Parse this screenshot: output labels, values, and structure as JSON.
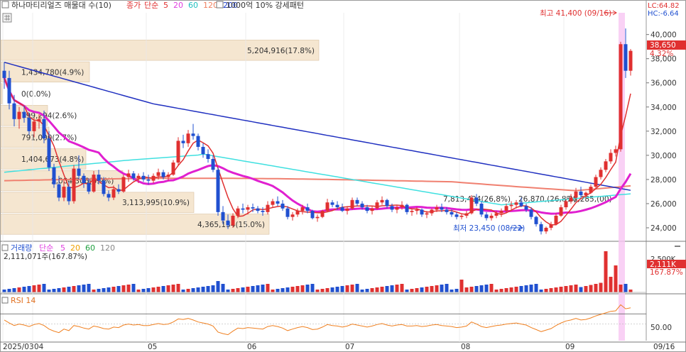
{
  "main_header": {
    "stock_name": "하나마티리얼즈 매물대 수(10)",
    "price_type": "종가",
    "ma_label": "단순",
    "ma_periods": [
      {
        "v": "5",
        "color": "#e03030"
      },
      {
        "v": "20",
        "color": "#e040e0"
      },
      {
        "v": "60",
        "color": "#20c0c0"
      },
      {
        "v": "120",
        "color": "#f08060"
      },
      {
        "v": "200",
        "color": "#2040d0"
      }
    ],
    "pattern_label": "1000억 10% 강세패턴"
  },
  "lc_label": "LC:64.82",
  "hc_label": "HC:-6.64",
  "price_scale": [
    "40,000",
    "38,000",
    "36,000",
    "34,000",
    "32,000",
    "30,000",
    "28,000",
    "26,000",
    "24,000"
  ],
  "current_price": "38,650",
  "current_change": "4.32%",
  "high_annotation": "최고 41,400 (09/16)",
  "low_annotation": "최저 23,450 (08/22)",
  "volume_profile": [
    {
      "price_hi": 41400,
      "price_lo": 39600,
      "label": "",
      "width": 0
    },
    {
      "price_hi": 39600,
      "price_lo": 37800,
      "label": "5,204,916(17.8%)",
      "width": 448
    },
    {
      "price_hi": 37800,
      "price_lo": 36000,
      "label": "1,434,780(4.9%)",
      "width": 125
    },
    {
      "price_hi": 36000,
      "price_lo": 34200,
      "label": "0(0.0%)",
      "width": 2
    },
    {
      "price_hi": 34200,
      "price_lo": 32400,
      "label": "799,294(2.6%)",
      "width": 66
    },
    {
      "price_hi": 32400,
      "price_lo": 30600,
      "label": "791,000(2.7%)",
      "width": 68
    },
    {
      "price_hi": 30600,
      "price_lo": 28800,
      "label": "1,404,673(4.8%)",
      "width": 120
    },
    {
      "price_hi": 28800,
      "price_lo": 27000,
      "label": "2,004,306(6.9%)",
      "width": 172
    },
    {
      "price_hi": 27000,
      "price_lo": 25200,
      "label": "3,113,995(10.9%)",
      "width": 272
    },
    {
      "price_hi": 25200,
      "price_lo": 23400,
      "label": "4,365,134(15.0%)",
      "width": 378
    }
  ],
  "volume_profile_extra": [
    "7,813,424(26,8%)",
    "26,870,(26,8%)",
    "28,285,(00)"
  ],
  "volume_header": {
    "label": "거래량",
    "ma_label": "단순",
    "periods": [
      {
        "v": "5",
        "color": "#e040e0"
      },
      {
        "v": "20",
        "color": "#f0a000"
      },
      {
        "v": "60",
        "color": "#20a040"
      },
      {
        "v": "120",
        "color": "#888888"
      }
    ]
  },
  "volume_value": "2,111,071주(167.87%)",
  "volume_scale": "2,500K",
  "volume_current": "2,111K",
  "volume_pct": "167.87%",
  "rsi_label": "RSI 14",
  "rsi_scale": "50.00",
  "x_axis": [
    "2025/03",
    "04",
    "05",
    "06",
    "07",
    "08",
    "09"
  ],
  "x_axis_right": "09/16",
  "chart_data": {
    "type": "candlestick",
    "y_range": [
      23000,
      41800
    ],
    "candles": [
      [
        37000,
        37700,
        35500,
        36400
      ],
      [
        36400,
        37000,
        33800,
        34300
      ],
      [
        34300,
        35000,
        32400,
        33000
      ],
      [
        33000,
        34000,
        32200,
        33600
      ],
      [
        33600,
        34100,
        32700,
        33100
      ],
      [
        33100,
        33500,
        31700,
        32000
      ],
      [
        32000,
        33100,
        31500,
        32800
      ],
      [
        32800,
        33400,
        32200,
        33000
      ],
      [
        33000,
        33700,
        31000,
        31400
      ],
      [
        31400,
        32000,
        28700,
        29000
      ],
      [
        29000,
        29300,
        27300,
        27600
      ],
      [
        27600,
        28300,
        26200,
        26500
      ],
      [
        26500,
        28000,
        26200,
        27400
      ],
      [
        27400,
        27800,
        25900,
        26200
      ],
      [
        26200,
        29200,
        26000,
        28900
      ],
      [
        28900,
        30000,
        28000,
        28300
      ],
      [
        28300,
        28500,
        27300,
        27700
      ],
      [
        27700,
        28100,
        26800,
        27000
      ],
      [
        27000,
        28700,
        26900,
        28400
      ],
      [
        28400,
        28800,
        27600,
        27900
      ],
      [
        27900,
        28200,
        26600,
        26800
      ],
      [
        26800,
        27100,
        26200,
        26500
      ],
      [
        26500,
        27500,
        26300,
        27200
      ],
      [
        27200,
        27600,
        26800,
        27000
      ],
      [
        27000,
        28400,
        26900,
        28200
      ],
      [
        28200,
        28800,
        27800,
        28500
      ],
      [
        28500,
        28700,
        27900,
        28100
      ],
      [
        28100,
        28500,
        27700,
        28300
      ],
      [
        28300,
        28600,
        27800,
        28000
      ],
      [
        28000,
        28400,
        27600,
        27900
      ],
      [
        27900,
        28500,
        27700,
        28300
      ],
      [
        28300,
        28900,
        28000,
        28600
      ],
      [
        28600,
        28800,
        28000,
        28200
      ],
      [
        28200,
        28600,
        27900,
        28400
      ],
      [
        28400,
        29600,
        28300,
        29400
      ],
      [
        29400,
        31500,
        29200,
        31200
      ],
      [
        31200,
        31700,
        30600,
        31000
      ],
      [
        31000,
        32100,
        30700,
        31800
      ],
      [
        31800,
        32600,
        31300,
        31600
      ],
      [
        31600,
        31800,
        30400,
        30700
      ],
      [
        30700,
        31000,
        29800,
        30100
      ],
      [
        30100,
        30500,
        29400,
        29700
      ],
      [
        29700,
        30000,
        28600,
        28800
      ],
      [
        28800,
        29000,
        25000,
        25300
      ],
      [
        25300,
        25800,
        24300,
        24600
      ],
      [
        24600,
        25100,
        23900,
        24200
      ],
      [
        24200,
        25200,
        24000,
        25000
      ],
      [
        25000,
        25800,
        24800,
        25600
      ],
      [
        25600,
        26000,
        25200,
        25500
      ],
      [
        25500,
        25900,
        25100,
        25700
      ],
      [
        25700,
        26000,
        25300,
        25600
      ],
      [
        25600,
        25800,
        25200,
        25400
      ],
      [
        25400,
        25700,
        25000,
        25300
      ],
      [
        25300,
        26200,
        25100,
        25900
      ],
      [
        25900,
        26400,
        25700,
        26200
      ],
      [
        26200,
        26600,
        25800,
        26000
      ],
      [
        26000,
        26300,
        25400,
        25600
      ],
      [
        25600,
        25800,
        24700,
        24900
      ],
      [
        24900,
        25300,
        24600,
        25100
      ],
      [
        25100,
        25600,
        24900,
        25400
      ],
      [
        25400,
        25900,
        25100,
        25700
      ],
      [
        25700,
        26000,
        25200,
        25400
      ],
      [
        25400,
        25500,
        24700,
        24800
      ],
      [
        24800,
        25100,
        24500,
        24900
      ],
      [
        24900,
        25500,
        24800,
        25400
      ],
      [
        25400,
        26400,
        25300,
        26100
      ],
      [
        26100,
        26300,
        25700,
        25900
      ],
      [
        25900,
        26200,
        25500,
        25700
      ],
      [
        25700,
        26000,
        25300,
        25400
      ],
      [
        25400,
        25800,
        25100,
        25600
      ],
      [
        25600,
        26500,
        25500,
        26300
      ],
      [
        26300,
        26500,
        25800,
        26000
      ],
      [
        26000,
        26200,
        25500,
        25700
      ],
      [
        25700,
        25900,
        25200,
        25400
      ],
      [
        25400,
        25800,
        25100,
        25600
      ],
      [
        25600,
        26300,
        25500,
        26100
      ],
      [
        26100,
        26600,
        25900,
        26300
      ],
      [
        26300,
        26400,
        25600,
        25800
      ],
      [
        25800,
        26000,
        25300,
        25500
      ],
      [
        25500,
        25900,
        25200,
        25700
      ],
      [
        25700,
        26200,
        25500,
        25900
      ],
      [
        25900,
        26000,
        25100,
        25300
      ],
      [
        25300,
        25600,
        25000,
        25400
      ],
      [
        25400,
        25700,
        25100,
        25500
      ],
      [
        25500,
        25600,
        24900,
        25100
      ],
      [
        25100,
        25400,
        24800,
        25200
      ],
      [
        25200,
        25600,
        25000,
        25500
      ],
      [
        25500,
        25900,
        25300,
        25700
      ],
      [
        25700,
        26000,
        25300,
        25500
      ],
      [
        25500,
        25700,
        25100,
        25300
      ],
      [
        25300,
        25500,
        24900,
        25100
      ],
      [
        25100,
        25300,
        24700,
        24900
      ],
      [
        24900,
        25200,
        24700,
        25000
      ],
      [
        25000,
        25400,
        24800,
        25200
      ],
      [
        25200,
        26700,
        25100,
        26500
      ],
      [
        26500,
        26800,
        25800,
        26000
      ],
      [
        26000,
        26200,
        24900,
        25100
      ],
      [
        25100,
        25300,
        24600,
        24800
      ],
      [
        24800,
        25200,
        24600,
        25000
      ],
      [
        25000,
        25400,
        24800,
        25200
      ],
      [
        25200,
        25600,
        24900,
        25400
      ],
      [
        25400,
        26000,
        25200,
        25800
      ],
      [
        25800,
        26200,
        25500,
        25900
      ],
      [
        25900,
        26300,
        25600,
        26100
      ],
      [
        26100,
        26500,
        25700,
        25800
      ],
      [
        25800,
        26000,
        25300,
        25500
      ],
      [
        25500,
        25700,
        24700,
        24900
      ],
      [
        24900,
        25000,
        24100,
        24300
      ],
      [
        24300,
        24500,
        23450,
        23700
      ],
      [
        23700,
        24100,
        23500,
        24000
      ],
      [
        24000,
        24500,
        23800,
        24300
      ],
      [
        24300,
        25200,
        24200,
        25000
      ],
      [
        25000,
        25900,
        24900,
        25700
      ],
      [
        25700,
        26400,
        25500,
        26200
      ],
      [
        26200,
        26800,
        26000,
        26500
      ],
      [
        26500,
        27300,
        26300,
        27000
      ],
      [
        27000,
        27400,
        26500,
        26700
      ],
      [
        26700,
        27000,
        26400,
        26900
      ],
      [
        26900,
        27600,
        26800,
        27400
      ],
      [
        27400,
        28400,
        27200,
        28200
      ],
      [
        28200,
        29000,
        28000,
        28800
      ],
      [
        28800,
        29700,
        28600,
        29500
      ],
      [
        29500,
        30500,
        29300,
        30200
      ],
      [
        30200,
        30800,
        29900,
        30500
      ],
      [
        30500,
        39400,
        30300,
        39200
      ],
      [
        39200,
        40500,
        36400,
        37000
      ],
      [
        37000,
        38800,
        36600,
        38650
      ]
    ]
  },
  "rsi_series": [
    58,
    52,
    47,
    50,
    48,
    45,
    49,
    51,
    47,
    40,
    36,
    33,
    40,
    37,
    47,
    45,
    42,
    40,
    46,
    44,
    41,
    40,
    44,
    43,
    48,
    50,
    48,
    49,
    47,
    47,
    49,
    51,
    49,
    50,
    54,
    60,
    59,
    61,
    58,
    54,
    52,
    50,
    46,
    34,
    31,
    29,
    36,
    42,
    41,
    43,
    42,
    41,
    40,
    45,
    47,
    45,
    42,
    37,
    40,
    43,
    45,
    43,
    39,
    40,
    44,
    49,
    47,
    46,
    44,
    46,
    50,
    48,
    46,
    44,
    46,
    49,
    51,
    48,
    46,
    48,
    49,
    46,
    46,
    47,
    45,
    46,
    48,
    49,
    47,
    46,
    45,
    43,
    44,
    46,
    54,
    50,
    45,
    43,
    45,
    47,
    48,
    50,
    51,
    52,
    50,
    48,
    43,
    39,
    35,
    38,
    41,
    47,
    52,
    56,
    58,
    61,
    58,
    59,
    62,
    66,
    69,
    72,
    75,
    76,
    88,
    80,
    82
  ]
}
